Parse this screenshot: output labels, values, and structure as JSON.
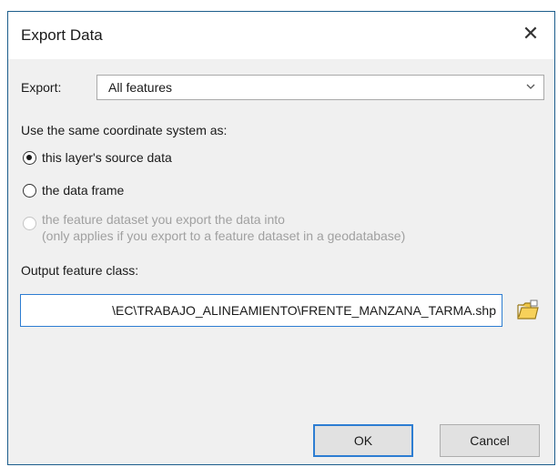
{
  "dialog": {
    "title": "Export Data",
    "close_glyph": "✕"
  },
  "export": {
    "label": "Export:",
    "selected": "All features"
  },
  "coordinate": {
    "label": "Use the same coordinate system as:",
    "options": [
      {
        "label": "this layer's source data",
        "selected": true,
        "enabled": true
      },
      {
        "label": "the data frame",
        "selected": false,
        "enabled": true
      },
      {
        "label": "the feature dataset you export the data into",
        "sublabel": "(only applies if you export to a feature dataset in a geodatabase)",
        "selected": false,
        "enabled": false
      }
    ]
  },
  "output": {
    "label": "Output feature class:",
    "value": "\\EC\\TRABAJO_ALINEAMIENTO\\FRENTE_MANZANA_TARMA.shp",
    "browse_icon": "folder-open-icon"
  },
  "buttons": {
    "ok": "OK",
    "cancel": "Cancel"
  }
}
